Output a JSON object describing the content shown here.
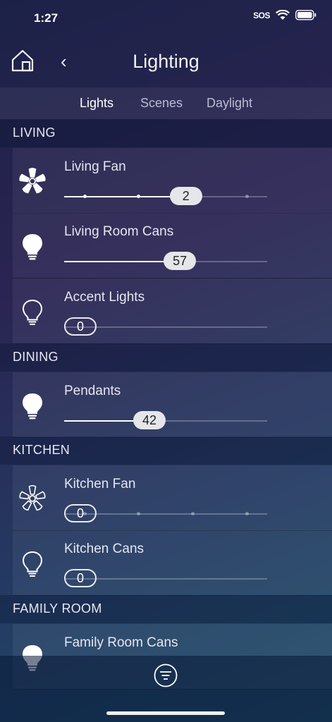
{
  "status": {
    "time": "1:27",
    "sos": "SOS"
  },
  "header": {
    "title": "Lighting"
  },
  "tabs": [
    {
      "label": "Lights",
      "active": true
    },
    {
      "label": "Scenes",
      "active": false
    },
    {
      "label": "Daylight",
      "active": false
    }
  ],
  "sections": [
    {
      "title": "LIVING"
    },
    {
      "title": "DINING"
    },
    {
      "title": "KITCHEN"
    },
    {
      "title": "FAMILY ROOM"
    }
  ],
  "devices": [
    {
      "label": "Living Fan",
      "type": "fan",
      "value": "2",
      "level": 0.6,
      "ticks": [
        0.1,
        0.366,
        0.633,
        0.9
      ],
      "on": true
    },
    {
      "label": "Living Room Cans",
      "type": "bulb",
      "value": "57",
      "level": 0.57,
      "on": true
    },
    {
      "label": "Accent Lights",
      "type": "bulb",
      "value": "0",
      "level": 0,
      "on": false
    },
    {
      "label": "Pendants",
      "type": "bulb",
      "value": "42",
      "level": 0.42,
      "on": true
    },
    {
      "label": "Kitchen Fan",
      "type": "fan",
      "value": "0",
      "level": 0,
      "ticks": [
        0.1,
        0.366,
        0.633,
        0.9
      ],
      "on": false
    },
    {
      "label": "Kitchen Cans",
      "type": "bulb",
      "value": "0",
      "level": 0,
      "on": false
    },
    {
      "label": "Family Room Cans",
      "type": "bulb",
      "on": true
    }
  ],
  "colors": {
    "thumb_fill": "#e4e6ea",
    "track_fill": "#ffffff"
  }
}
